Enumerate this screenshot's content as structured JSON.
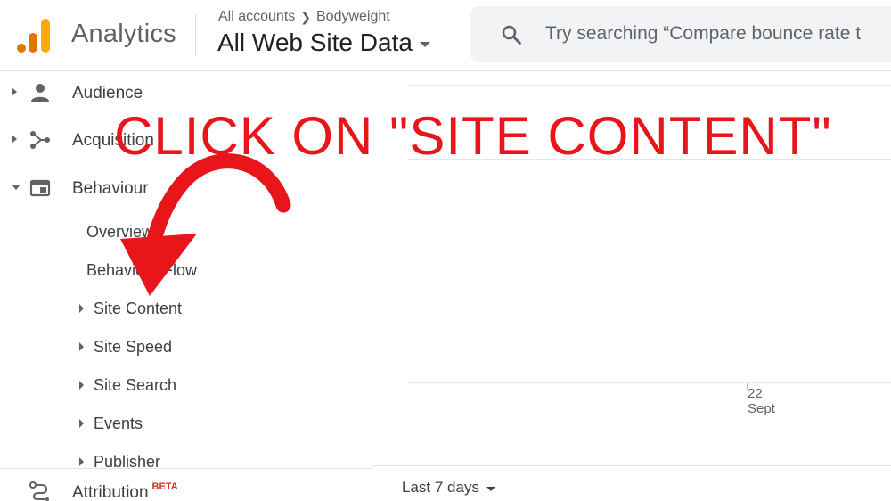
{
  "header": {
    "product_name": "Analytics",
    "breadcrumb": {
      "account": "All accounts",
      "property": "Bodyweight"
    },
    "view_name": "All Web Site Data",
    "search": {
      "placeholder": "Try searching “Compare bounce rate t"
    }
  },
  "sidebar": {
    "sections": [
      {
        "label": "Audience",
        "icon": "person-icon"
      },
      {
        "label": "Acquisition",
        "icon": "acquisition-icon"
      },
      {
        "label": "Behaviour",
        "icon": "behaviour-icon"
      }
    ],
    "behaviour_items": [
      {
        "label": "Overview"
      },
      {
        "label": "Behaviour Flow"
      },
      {
        "label": "Site Content"
      },
      {
        "label": "Site Speed"
      },
      {
        "label": "Site Search"
      },
      {
        "label": "Events"
      },
      {
        "label": "Publisher"
      }
    ],
    "attribution": {
      "label": "Attribution",
      "badge": "BETA"
    }
  },
  "chart": {
    "tick_day": "22",
    "tick_month": "Sept"
  },
  "footer": {
    "date_range": "Last 7 days"
  },
  "annotation": {
    "text": "CLICK ON \"SITE CONTENT\"",
    "color": "#e8161b"
  },
  "colors": {
    "logo_orange_dark": "#e37400",
    "logo_orange": "#f9ab00",
    "annotation_red": "#e8161b"
  }
}
